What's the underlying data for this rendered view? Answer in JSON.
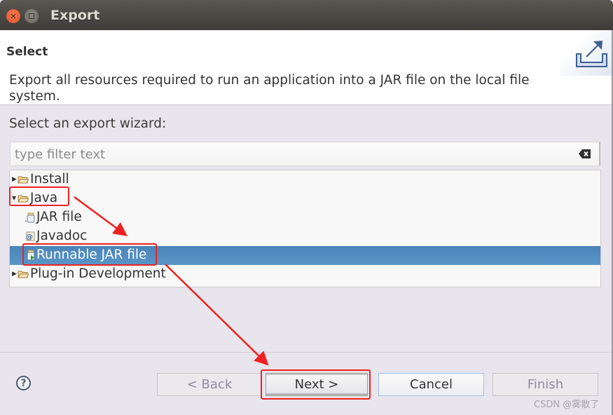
{
  "window": {
    "title": "Export",
    "controls": [
      "close",
      "maximize"
    ]
  },
  "header": {
    "title": "Select",
    "description": "Export all resources required to run an application into a JAR file on the local file system.",
    "icon": "export-wizard-icon"
  },
  "wizard": {
    "label": "Select an export wizard:",
    "filter": {
      "value": "",
      "placeholder": "type filter text",
      "clear_icon": "clear-backspace-icon"
    },
    "tree": [
      {
        "label": "Install",
        "icon": "folder-icon",
        "expanded": false,
        "depth": 0
      },
      {
        "label": "Java",
        "icon": "folder-icon",
        "expanded": true,
        "depth": 0
      },
      {
        "label": "JAR file",
        "icon": "jar-icon",
        "depth": 1
      },
      {
        "label": "Javadoc",
        "icon": "javadoc-icon",
        "depth": 1
      },
      {
        "label": "Runnable JAR file",
        "icon": "runnable-jar-icon",
        "depth": 1,
        "selected": true
      },
      {
        "label": "Plug-in Development",
        "icon": "folder-icon",
        "expanded": false,
        "depth": 0
      }
    ]
  },
  "footer": {
    "help_icon": "?",
    "back_label": "< Back",
    "next_label": "Next >",
    "cancel_label": "Cancel",
    "finish_label": "Finish",
    "back_enabled": false,
    "finish_enabled": false
  },
  "annotation": {
    "color": "#ee2222",
    "highlighted": [
      "Java",
      "Runnable JAR file",
      "Next >"
    ]
  },
  "watermark": "CSDN @雾散了",
  "colors": {
    "selection": "#4f8bbf",
    "titlebar": "#4a4844",
    "background": "#e8e5ec"
  }
}
